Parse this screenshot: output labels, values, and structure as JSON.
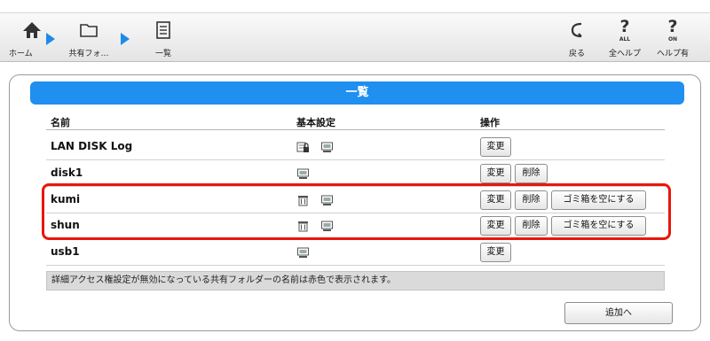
{
  "toolbar": {
    "home_label": "ホーム",
    "share_label": "共有フォ…",
    "list_label": "一覧",
    "back_label": "戻る",
    "all_help_label": "全ヘルプ",
    "all_help_sub": "ALL",
    "help_on_label": "ヘルプ有",
    "help_on_sub": "ON",
    "help_glyph": "?"
  },
  "panel": {
    "title": "一覧",
    "headers": {
      "name": "名前",
      "settings": "基本設定",
      "actions": "操作"
    },
    "rows": [
      {
        "name": "LAN DISK Log",
        "icons": [
          "locked-folder-icon",
          "share-icon"
        ],
        "actions": [
          "変更"
        ]
      },
      {
        "name": "disk1",
        "icons": [
          "share-icon"
        ],
        "actions": [
          "変更",
          "削除"
        ]
      },
      {
        "name": "kumi",
        "icons": [
          "trash-icon",
          "share-icon"
        ],
        "actions": [
          "変更",
          "削除",
          "ゴミ箱を空にする"
        ]
      },
      {
        "name": "shun",
        "icons": [
          "trash-icon",
          "share-icon"
        ],
        "actions": [
          "変更",
          "削除",
          "ゴミ箱を空にする"
        ]
      },
      {
        "name": "usb1",
        "icons": [
          "share-icon"
        ],
        "actions": [
          "変更"
        ]
      }
    ],
    "notice": "詳細アクセス権設定が無効になっている共有フォルダーの名前は赤色で表示されます。",
    "add_button": "追加へ"
  },
  "colors": {
    "accent": "#1f8ff0",
    "highlight": "#e8170b"
  }
}
